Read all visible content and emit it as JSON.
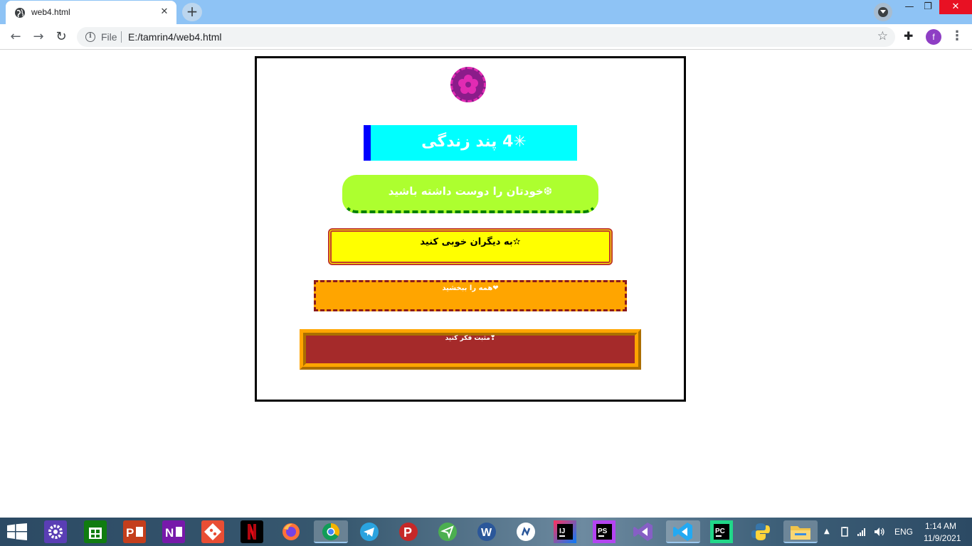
{
  "browser": {
    "tab_title": "web4.html",
    "tab_close": "✕",
    "new_tab": "+",
    "window_minimize": "—",
    "window_restore": "❐",
    "window_close": "✕",
    "back": "←",
    "forward": "→",
    "reload": "↻",
    "scheme_label": "File",
    "url": "E:/tamrin4/web4.html",
    "bookmark_star": "☆",
    "extensions": "✚",
    "profile_initial": "f",
    "menu": "⋮"
  },
  "page": {
    "heading": "✳4 پند زندگی",
    "items": [
      "❆خودتان را دوست داشته باشید",
      "✫به دیگران خوبی کنید",
      "❤همه را ببخشید",
      "❣مثبت فکر کنید"
    ]
  },
  "taskbar": {
    "apps": [
      "windows-start",
      "settings",
      "store",
      "powerpoint",
      "onenote",
      "git",
      "netflix",
      "firefox",
      "chrome",
      "telegram",
      "psiphon",
      "pushbullet",
      "word",
      "whatsapp",
      "intellij",
      "phpstorm",
      "visual-studio",
      "vscode",
      "pycharm",
      "python",
      "file-explorer"
    ],
    "language": "ENG",
    "time": "1:14 AM",
    "date": "11/9/2021"
  },
  "colors": {
    "titlebar": "#8ec3f5",
    "heading_bg": "#00ffff",
    "heading_border": "#0000ff",
    "item1_bg": "#adff2f",
    "item2_bg": "#ffff00",
    "item3_bg": "#ffa500",
    "item4_bg": "#a52a2a"
  }
}
